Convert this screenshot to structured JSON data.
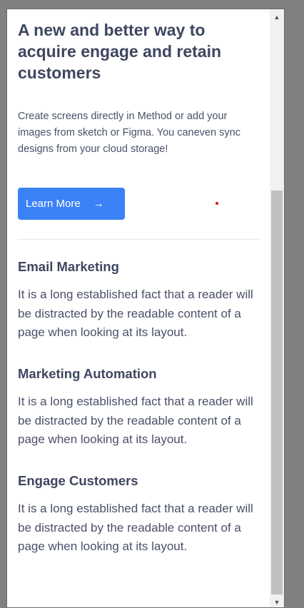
{
  "hero": {
    "title": "A new and better way to acquire engage and retain customers",
    "description": "Create screens directly in Method or add your images from sketch or Figma. You caneven sync designs from your cloud storage!",
    "button_label": "Learn More",
    "button_icon": "arrow-right-icon"
  },
  "features": [
    {
      "title": "Email Marketing",
      "text": "It is a long established fact that a reader will be distracted by the readable content of a page when looking at its layout."
    },
    {
      "title": "Marketing Automation",
      "text": "It is a long established fact that a reader will be distracted by the readable content of a page when looking at its layout."
    },
    {
      "title": "Engage Customers",
      "text": "It is a long established fact that a reader will be distracted by the readable content of a page when looking at its layout."
    }
  ],
  "colors": {
    "accent": "#3b82f6",
    "heading": "#3f4660",
    "body_text": "#4a5068",
    "background": "#808080"
  }
}
